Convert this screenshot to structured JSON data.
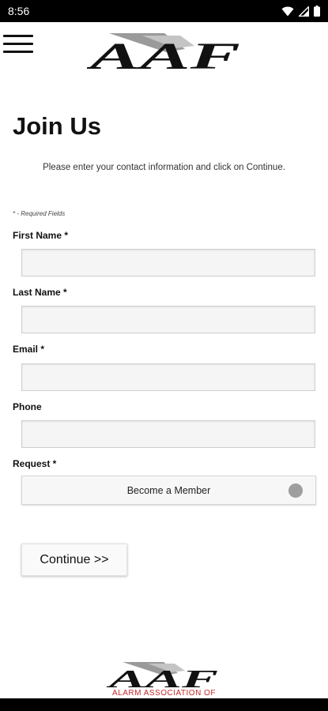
{
  "status_bar": {
    "time": "8:56"
  },
  "header": {
    "logo_text": "AAF"
  },
  "page": {
    "title": "Join Us",
    "intro": "Please enter your contact information and click on Continue.",
    "required_note": "* - Required Fields"
  },
  "form": {
    "first_name": {
      "label": "First Name *",
      "value": "",
      "placeholder": ""
    },
    "last_name": {
      "label": "Last Name *",
      "value": "",
      "placeholder": ""
    },
    "email": {
      "label": "Email *",
      "value": "",
      "placeholder": ""
    },
    "phone": {
      "label": "Phone",
      "value": "",
      "placeholder": ""
    },
    "request": {
      "label": "Request *",
      "selected": "Become a Member"
    }
  },
  "continue_label": "Continue >>",
  "footer": {
    "logo_text": "AAF",
    "org_text": "ALARM ASSOCIATION OF"
  },
  "colors": {
    "accent_red": "#c62828",
    "status_bar": "#000000"
  }
}
